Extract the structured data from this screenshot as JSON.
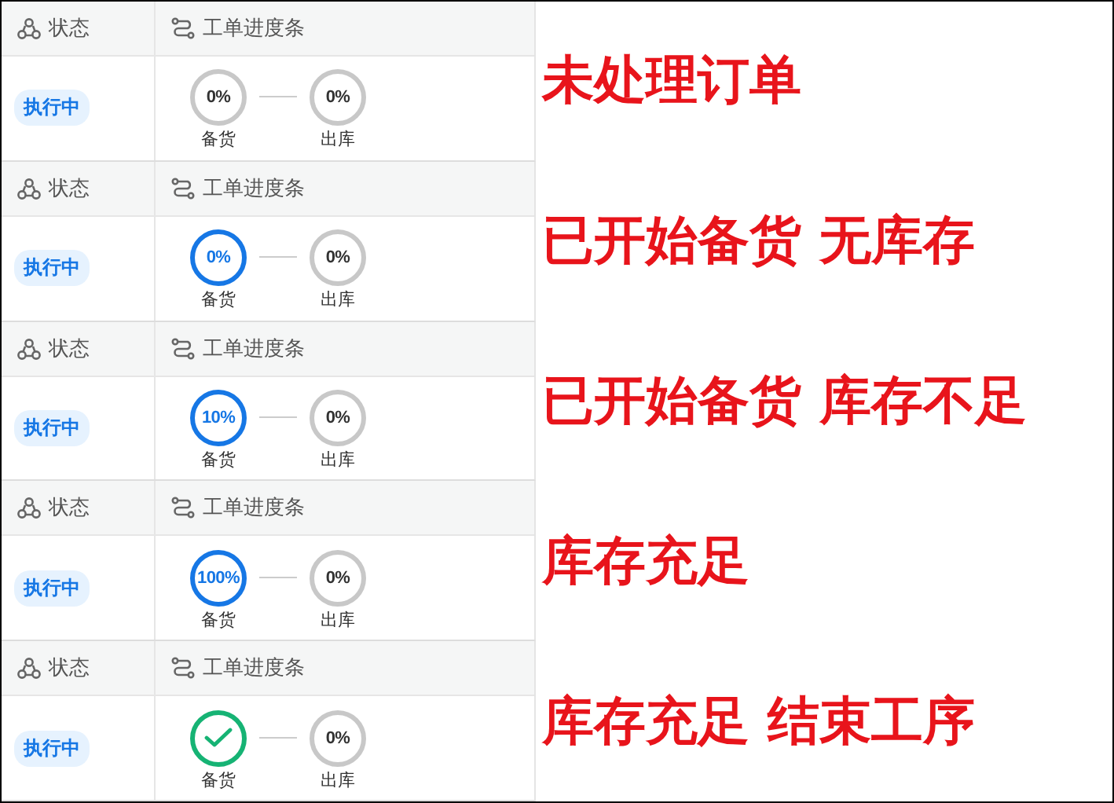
{
  "panels": [
    {
      "columns": [
        "状态",
        "工单进度条"
      ],
      "status": "执行中",
      "steps": [
        {
          "kind": "percent",
          "label": "备货",
          "value": "0%",
          "active": false
        },
        {
          "kind": "percent",
          "label": "出库",
          "value": "0%",
          "active": false
        }
      ],
      "caption": "未处理订单"
    },
    {
      "columns": [
        "状态",
        "工单进度条"
      ],
      "status": "执行中",
      "steps": [
        {
          "kind": "percent",
          "label": "备货",
          "value": "0%",
          "active": true
        },
        {
          "kind": "percent",
          "label": "出库",
          "value": "0%",
          "active": false
        }
      ],
      "caption": "已开始备货 无库存"
    },
    {
      "columns": [
        "状态",
        "工单进度条"
      ],
      "status": "执行中",
      "steps": [
        {
          "kind": "percent",
          "label": "备货",
          "value": "10%",
          "active": true
        },
        {
          "kind": "percent",
          "label": "出库",
          "value": "0%",
          "active": false
        }
      ],
      "caption": "已开始备货 库存不足"
    },
    {
      "columns": [
        "状态",
        "工单进度条"
      ],
      "status": "执行中",
      "steps": [
        {
          "kind": "percent",
          "label": "备货",
          "value": "100%",
          "active": true
        },
        {
          "kind": "percent",
          "label": "出库",
          "value": "0%",
          "active": false
        }
      ],
      "caption": "库存充足"
    },
    {
      "columns": [
        "状态",
        "工单进度条"
      ],
      "status": "执行中",
      "steps": [
        {
          "kind": "done",
          "label": "备货"
        },
        {
          "kind": "percent",
          "label": "出库",
          "value": "0%",
          "active": false
        }
      ],
      "caption": "库存充足 结束工序"
    }
  ]
}
